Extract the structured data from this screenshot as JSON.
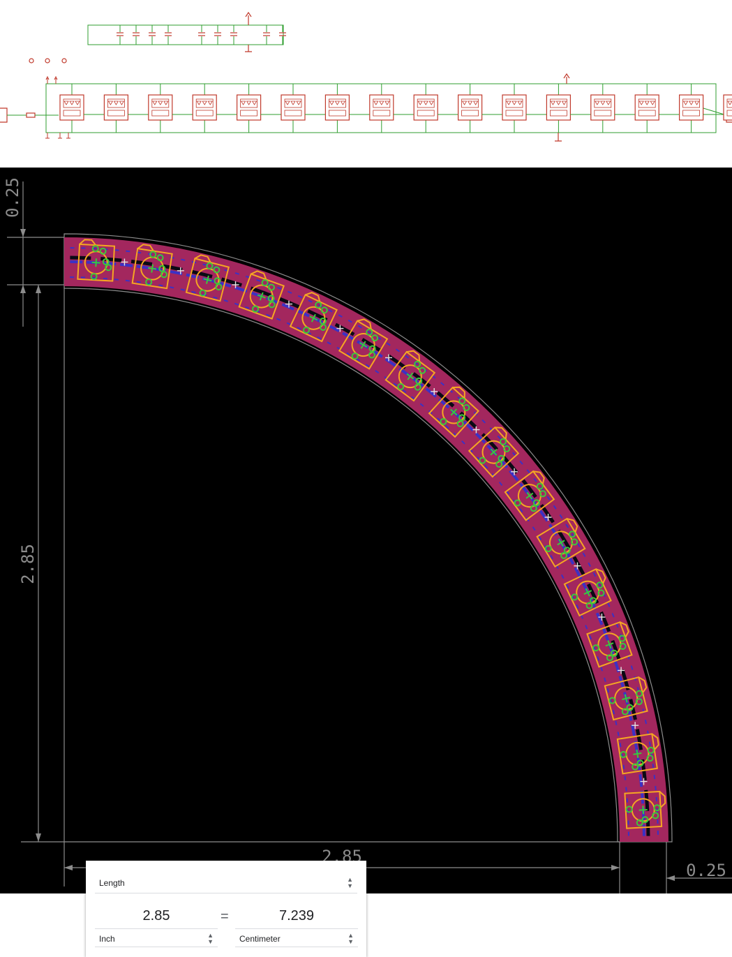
{
  "dimensions": {
    "top": "0.25",
    "left": "2.85",
    "bottom": "2.85",
    "bottom_right": "0.25"
  },
  "converter": {
    "quantity": "Length",
    "from_value": "2.85",
    "from_unit": "Inch",
    "equals": "=",
    "to_value": "7.239",
    "to_unit": "Centimeter"
  },
  "board": {
    "led_count": 16,
    "colors": {
      "background": "#000000",
      "copper_top": "#a3275e",
      "copper_bottom": "#2a34d6",
      "silkscreen": "#f5a623",
      "pads": "#3cc83c",
      "dimension_lines": "#8c8c8c"
    }
  },
  "schematic": {
    "led_module_count": 16,
    "colors": {
      "wire": "#2f9e2f",
      "component": "#c0392b"
    }
  }
}
